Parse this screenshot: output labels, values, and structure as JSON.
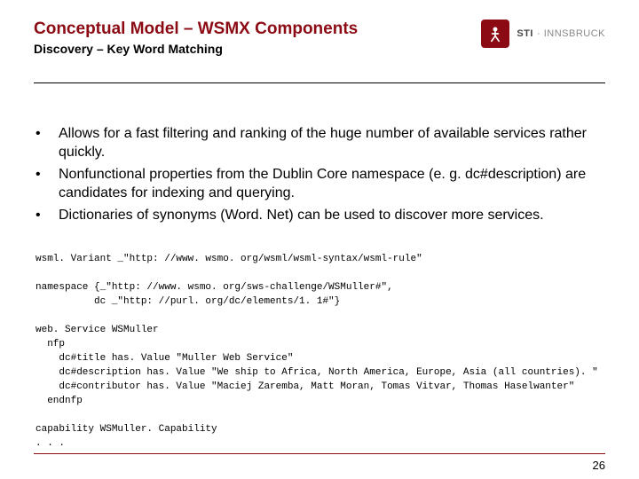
{
  "header": {
    "title": "Conceptual Model – WSMX Components",
    "subtitle": "Discovery – Key Word Matching"
  },
  "logo": {
    "primary": "STI",
    "secondary": "INNSBRUCK"
  },
  "bullets": [
    "Allows for a fast filtering and ranking of the huge number of available services rather quickly.",
    "Nonfunctional properties from the Dublin Core namespace (e. g. dc#description) are candidates for indexing and querying.",
    "Dictionaries of synonyms (Word. Net) can be used to discover more services."
  ],
  "code": "wsml. Variant _\"http: //www. wsmo. org/wsml/wsml-syntax/wsml-rule\"\n\nnamespace {_\"http: //www. wsmo. org/sws-challenge/WSMuller#\",\n          dc _\"http: //purl. org/dc/elements/1. 1#\"}\n\nweb. Service WSMuller\n  nfp\n    dc#title has. Value \"Muller Web Service\"\n    dc#description has. Value \"We ship to Africa, North America, Europe, Asia (all countries). \"\n    dc#contributor has. Value \"Maciej Zaremba, Matt Moran, Tomas Vitvar, Thomas Haselwanter\"\n  endnfp\n\ncapability WSMuller. Capability\n. . .",
  "page_number": "26"
}
